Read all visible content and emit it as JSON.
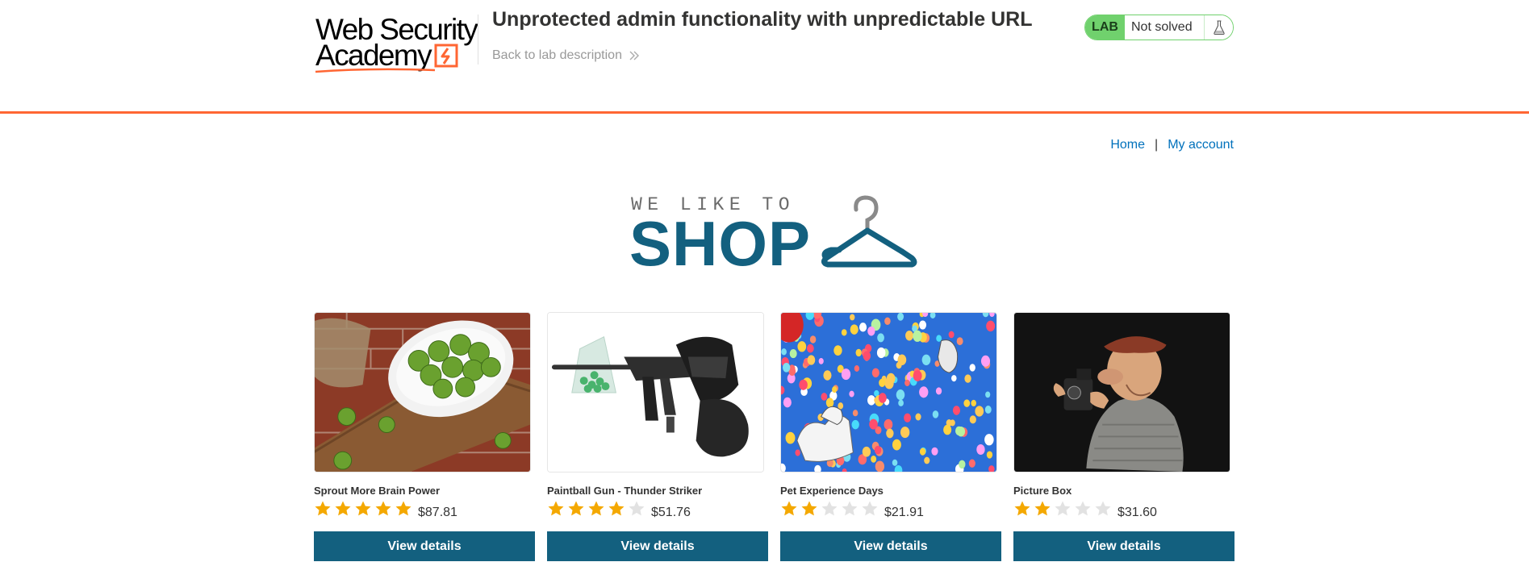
{
  "header": {
    "logo_line1": "Web Security",
    "logo_line2": "Academy",
    "lab_title": "Unprotected admin functionality with unpredictable URL",
    "back_link": "Back to lab description",
    "lab_badge": "LAB",
    "lab_status": "Not solved",
    "colors": {
      "accent": "#ff6633",
      "lab_green": "#70d16d"
    }
  },
  "nav": {
    "home": "Home",
    "separator": "|",
    "my_account": "My account"
  },
  "banner": {
    "tagline": "WE LIKE TO",
    "title": "SHOP"
  },
  "products": [
    {
      "name": "Sprout More Brain Power",
      "rating": 5,
      "price": "$87.81",
      "button": "View details",
      "image": "brussels-sprouts-bowl"
    },
    {
      "name": "Paintball Gun - Thunder Striker",
      "rating": 4,
      "price": "$51.76",
      "button": "View details",
      "image": "paintball-gun"
    },
    {
      "name": "Pet Experience Days",
      "rating": 2,
      "price": "$21.91",
      "button": "View details",
      "image": "dogs-balloons"
    },
    {
      "name": "Picture Box",
      "rating": 2,
      "price": "$31.60",
      "button": "View details",
      "image": "old-photographer-figurine"
    }
  ],
  "colors": {
    "primary": "#13607f",
    "link": "#0071bc",
    "star_on": "#f4a800",
    "star_off": "#e2e2e2"
  }
}
